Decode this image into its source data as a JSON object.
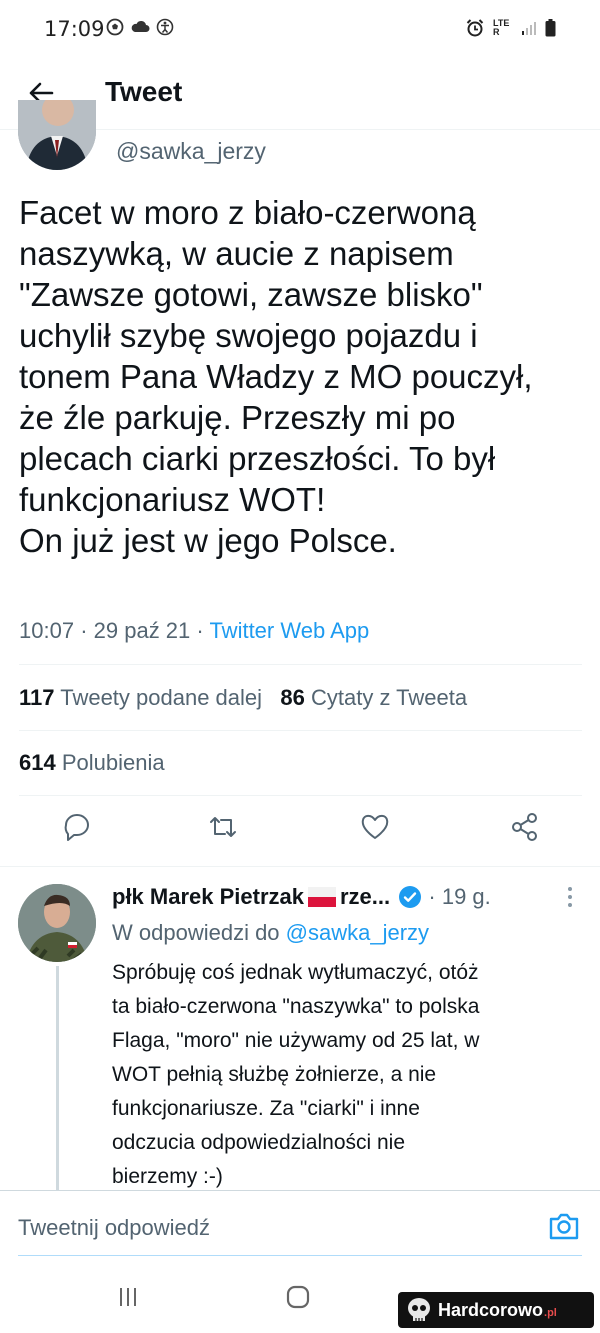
{
  "status_bar": {
    "time": "17:09",
    "left_icons": [
      "soccer-ball-icon",
      "cloud-icon",
      "accessibility-icon"
    ],
    "right_icons": [
      "alarm-icon",
      "lte-icon",
      "signal-icon",
      "battery-icon"
    ],
    "network": "LTE R"
  },
  "header": {
    "title": "Tweet",
    "back_icon": "arrow-left-icon"
  },
  "tweet": {
    "handle": "@sawka_jerzy",
    "text": "Facet w  moro z biało-czerwoną\nnaszywką, w aucie z napisem\n\"Zawsze gotowi, zawsze blisko\"\nuchylił szybę  swojego pojazdu i\ntonem Pana Władzy z MO pouczył,\nże źle parkuję. Przeszły mi po\nplecach ciarki przeszłości.  To był\nfunkcjonariusz WOT!\nOn już jest w jego Polsce.",
    "time": "10:07",
    "date": "29 paź 21",
    "source": "Twitter Web App",
    "retweets_count": "117",
    "retweets_label": "Tweety podane dalej",
    "quotes_count": "86",
    "quotes_label": "Cytaty z Tweeta",
    "likes_count": "614",
    "likes_label": "Polubienia"
  },
  "actions": [
    "reply-icon",
    "retweet-icon",
    "like-icon",
    "share-icon"
  ],
  "reply": {
    "name": "płk Marek Pietrzak",
    "name_suffix": "rze...",
    "age": "19 g.",
    "replying_prefix": "W odpowiedzi do",
    "replying_to": "@sawka_jerzy",
    "text": "Spróbuję coś jednak wytłumaczyć, otóż\nta biało-czerwona \"naszywka\" to polska\nFlaga, \"moro\" nie używamy od 25 lat, w\nWOT pełnią służbę żołnierze, a nie\nfunkcjonariusze. Za \"ciarki\" i inne\nodczucia odpowiedzialności nie\nbierzemy :-)"
  },
  "composer": {
    "placeholder": "Tweetnij odpowiedź"
  },
  "watermark": {
    "text": "Hardcorowo",
    "suffix": ".pl"
  },
  "colors": {
    "accent": "#1d9bf0",
    "text": "#0f1419",
    "secondary": "#536471",
    "divider": "#eff3f4"
  }
}
